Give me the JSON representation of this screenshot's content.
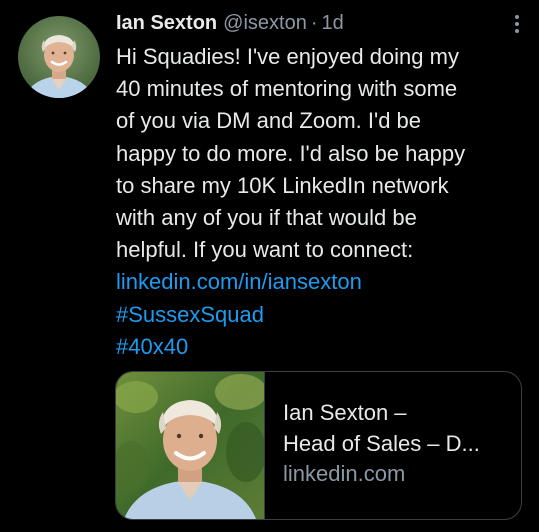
{
  "tweet": {
    "author_name": "Ian Sexton",
    "author_handle": "@isexton",
    "separator": "·",
    "time": "1d",
    "text_lines": [
      "Hi Squadies! I've enjoyed doing my",
      "40 minutes of mentoring with some",
      "of you via DM and Zoom. I'd be",
      "happy to do more. I'd also be happy",
      "to share my 10K LinkedIn network",
      "with any of you if that would be",
      "helpful. If you want to connect:"
    ],
    "link": "linkedin.com/in/iansexton",
    "hashtags": [
      "#SussexSquad",
      "#40x40"
    ]
  },
  "card": {
    "title_line1": "Ian Sexton –",
    "title_line2": "Head of Sales – D...",
    "domain": "linkedin.com"
  },
  "icons": {
    "more": "more-options-icon",
    "avatar": "avatar-photo",
    "thumbnail": "profile-thumbnail-photo"
  },
  "colors": {
    "background": "#000000",
    "text": "#e7e9ea",
    "muted": "#8b98a5",
    "link": "#1d9bf0",
    "border": "#3a3f44"
  }
}
